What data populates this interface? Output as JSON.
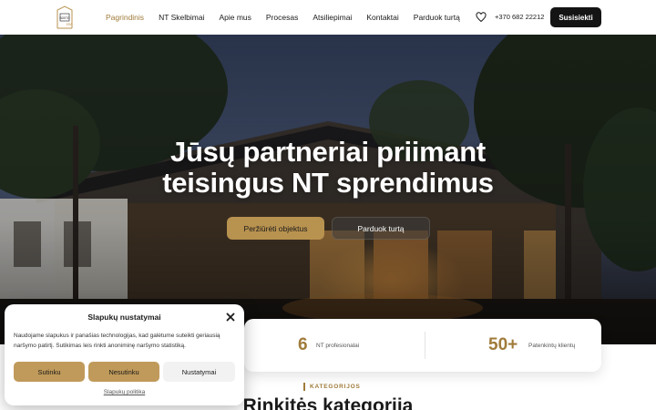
{
  "header": {
    "logo_alt": "Būsto Era",
    "nav": [
      {
        "label": "Pagrindinis",
        "active": true
      },
      {
        "label": "NT Skelbimai",
        "active": false
      },
      {
        "label": "Apie mus",
        "active": false
      },
      {
        "label": "Procesas",
        "active": false
      },
      {
        "label": "Atsiliepimai",
        "active": false
      },
      {
        "label": "Kontaktai",
        "active": false
      },
      {
        "label": "Parduok turtą",
        "active": false
      }
    ],
    "favorites_icon": "heart-icon",
    "phone": "+370 682 22212",
    "contact_button": "Susisiekti"
  },
  "hero": {
    "title_line1": "Jūsų partneriai priimant",
    "title_line2": "teisingus NT sprendimus",
    "primary_button": "Peržiūrėti objektus",
    "secondary_button": "Parduok turtą"
  },
  "stats": [
    {
      "value": "6",
      "label": "NT profesionalai"
    },
    {
      "value": "50+",
      "label": "Patenkintų klientų"
    }
  ],
  "categories": {
    "tag": "KATEGORIJOS",
    "title": "Rinkitės kategoriją"
  },
  "cookie": {
    "title": "Slapukų nustatymai",
    "text": "Naudojame slapukus ir panašias technologijas, kad galėtume suteikti geriausią naršymo patirtį. Sutikimas leis rinkti anoniminę naršymo statistiką.",
    "accept": "Sutinku",
    "decline": "Nesutinku",
    "settings": "Nustatymai",
    "policy_link": "Slapukų politika",
    "close_icon": "close-icon"
  },
  "colors": {
    "accent": "#a07b3a",
    "button_gold": "#b8924f",
    "dark": "#141414"
  }
}
